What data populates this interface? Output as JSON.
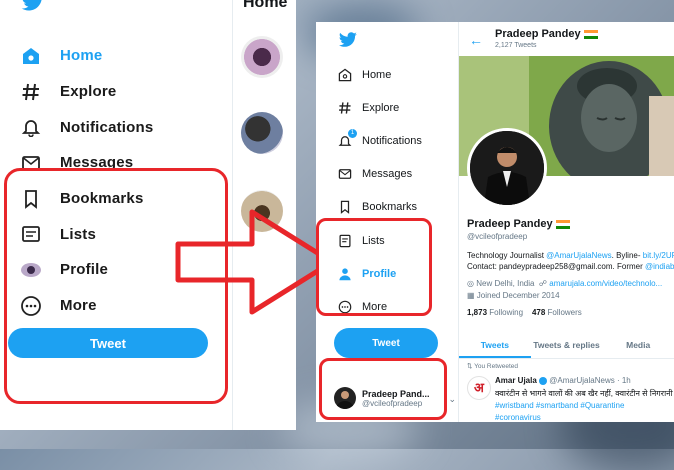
{
  "left_panel": {
    "nav": [
      {
        "label": "Home",
        "icon": "home-icon",
        "active": true
      },
      {
        "label": "Explore",
        "icon": "hashtag-icon"
      },
      {
        "label": "Notifications",
        "icon": "bell-icon"
      },
      {
        "label": "Messages",
        "icon": "envelope-icon"
      },
      {
        "label": "Bookmarks",
        "icon": "bookmark-icon"
      },
      {
        "label": "Lists",
        "icon": "list-icon"
      },
      {
        "label": "Profile",
        "icon": "profile-avatar-icon"
      },
      {
        "label": "More",
        "icon": "more-icon"
      }
    ],
    "tweet_button": "Tweet",
    "feed_title": "Home"
  },
  "right_panel": {
    "nav": [
      {
        "label": "Home",
        "icon": "home-icon"
      },
      {
        "label": "Explore",
        "icon": "hashtag-icon"
      },
      {
        "label": "Notifications",
        "icon": "bell-icon",
        "badge": "1"
      },
      {
        "label": "Messages",
        "icon": "envelope-icon"
      },
      {
        "label": "Bookmarks",
        "icon": "bookmark-icon"
      },
      {
        "label": "Lists",
        "icon": "list-icon"
      },
      {
        "label": "Profile",
        "icon": "person-icon",
        "active": true
      },
      {
        "label": "More",
        "icon": "more-icon"
      }
    ],
    "tweet_button": "Tweet",
    "account": {
      "name": "Pradeep Pand...",
      "handle": "@vcileofpradeep"
    },
    "profile": {
      "header_name": "Pradeep Pandey",
      "tweet_count": "2,127 Tweets",
      "name": "Pradeep Pandey",
      "handle": "@vcileofpradeep",
      "bio_line1_prefix": "Technology Journalist ",
      "bio_link1": "@AmarUjalaNews",
      "bio_line1_mid": ". Byline- ",
      "bio_link2": "bit.ly/2UFyy.r",
      "bio_line2_prefix": "Contact: pandeypradeep258@gmail.com. Former ",
      "bio_link3": "@indiabar",
      "location": "New Delhi, India",
      "website": "amarujala.com/video/technolo...",
      "joined": "Joined December 2014",
      "following_count": "1,873",
      "following_label": "Following",
      "followers_count": "478",
      "followers_label": "Followers",
      "tabs": [
        "Tweets",
        "Tweets & replies",
        "Media"
      ],
      "retweet_label": "You Retweeted",
      "tweet": {
        "logo_text": "अ",
        "author": "Amar Ujala",
        "handle_time": "@AmarUjalaNews · 1h",
        "text": "क्वारंटीन से भागने वालों की अब खैर नहीं, क्वारंटीन से निगरानी करे",
        "tags": "#wristband #smartband #Quarantine",
        "tags2": "#coronavirus"
      }
    }
  },
  "colors": {
    "twitter_blue": "#1da1f2",
    "highlight_red": "#e8262a",
    "arrow_red": "#e8262a"
  }
}
